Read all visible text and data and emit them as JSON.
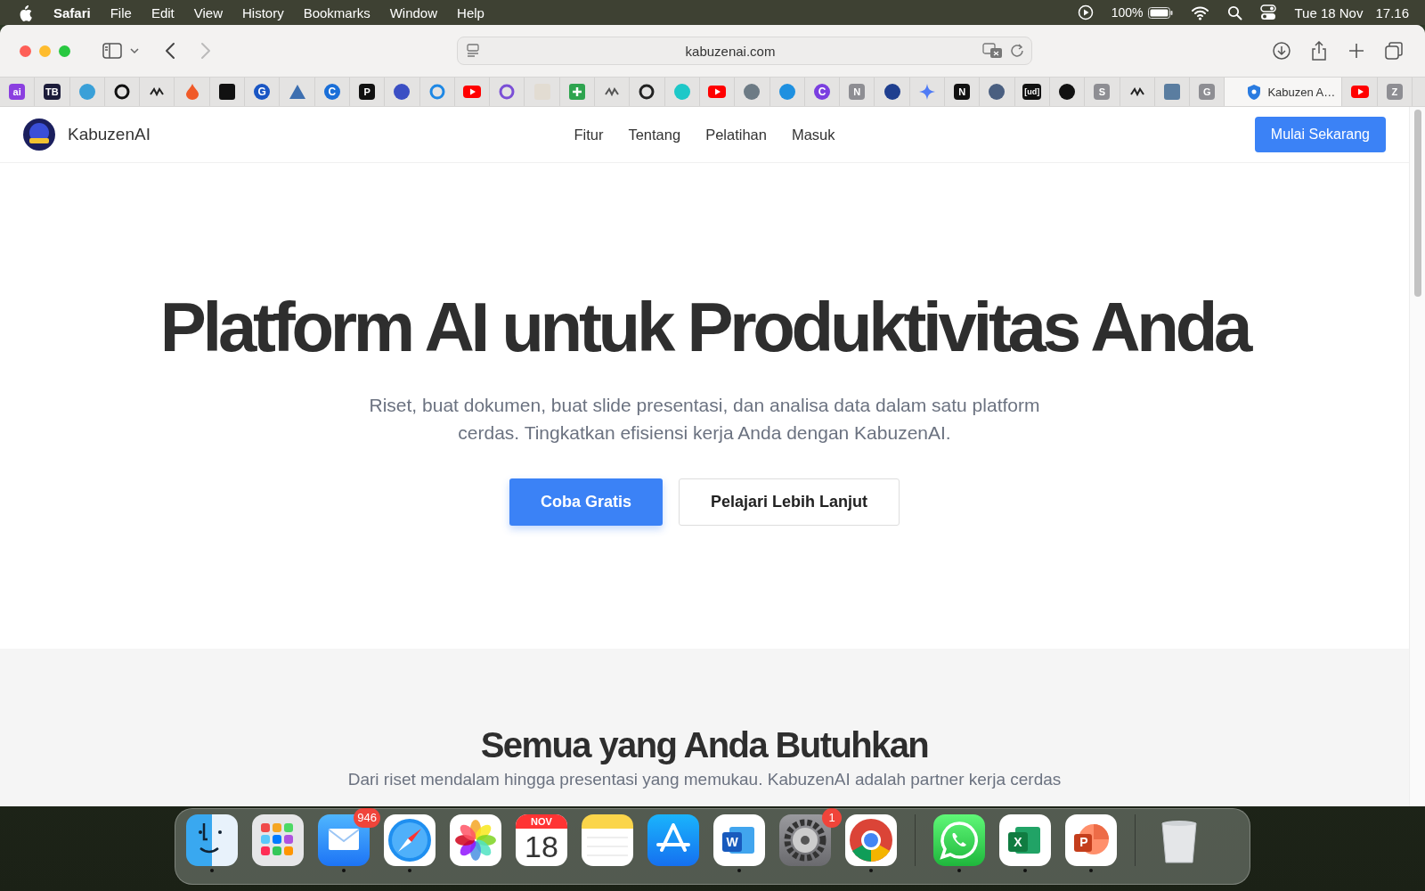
{
  "menu_bar": {
    "app": "Safari",
    "menus": [
      "File",
      "Edit",
      "View",
      "History",
      "Bookmarks",
      "Window",
      "Help"
    ],
    "battery": "100%",
    "date": "Tue 18 Nov",
    "time": "17.16"
  },
  "browser": {
    "address": "kabuzenai.com",
    "back_disabled": false,
    "forward_disabled": true
  },
  "tabs": [
    {
      "kind": "letter",
      "glyph": "ai",
      "color": "#8b3fe0",
      "selected": false
    },
    {
      "kind": "letter",
      "glyph": "TB",
      "color": "#1c1c3a",
      "selected": false
    },
    {
      "kind": "circle",
      "color": "#3aa0d8",
      "selected": false
    },
    {
      "kind": "ring",
      "color": "#111111",
      "selected": false
    },
    {
      "kind": "squiggle",
      "color": "#222222",
      "selected": false
    },
    {
      "kind": "drop",
      "color": "#f05a28",
      "selected": false
    },
    {
      "kind": "square",
      "color": "#111111",
      "selected": false
    },
    {
      "kind": "letter_round",
      "glyph": "G",
      "color": "#1a56c4",
      "selected": false
    },
    {
      "kind": "triangle",
      "color": "#3d6fb0",
      "selected": false
    },
    {
      "kind": "letter_round",
      "glyph": "C",
      "color": "#1a6fd8",
      "selected": false
    },
    {
      "kind": "letter",
      "glyph": "P",
      "color": "#111111",
      "selected": false
    },
    {
      "kind": "circle",
      "color": "#3b4fc4",
      "selected": false
    },
    {
      "kind": "ring",
      "color": "#1e88e5",
      "selected": false
    },
    {
      "kind": "play",
      "color": "#ff0000",
      "selected": false
    },
    {
      "kind": "ring",
      "color": "#7b4fd6",
      "selected": false
    },
    {
      "kind": "square",
      "color": "#e2dcd2",
      "selected": false
    },
    {
      "kind": "plus",
      "color": "#2ea44f",
      "selected": false
    },
    {
      "kind": "squiggle",
      "color": "#555555",
      "selected": false
    },
    {
      "kind": "ring",
      "color": "#222222",
      "selected": false
    },
    {
      "kind": "circle",
      "color": "#1ec8c8",
      "selected": false
    },
    {
      "kind": "play",
      "color": "#ff0000",
      "selected": false
    },
    {
      "kind": "circle",
      "color": "#6d7b85",
      "selected": false
    },
    {
      "kind": "circle",
      "color": "#1e90e0",
      "selected": false
    },
    {
      "kind": "letter_round",
      "glyph": "C",
      "color": "#7b3fe0",
      "selected": false
    },
    {
      "kind": "letter",
      "glyph": "N",
      "color": "#8e8e93",
      "selected": false
    },
    {
      "kind": "circle",
      "color": "#1f3f8f",
      "selected": false
    },
    {
      "kind": "star",
      "color": "#4f7bf5",
      "selected": false
    },
    {
      "kind": "letter",
      "glyph": "N",
      "color": "#111111",
      "selected": false
    },
    {
      "kind": "circle",
      "color": "#4a5f80",
      "selected": false
    },
    {
      "kind": "letter",
      "glyph": "[ud]",
      "color": "#111111",
      "selected": false
    },
    {
      "kind": "circle",
      "color": "#111111",
      "selected": false
    },
    {
      "kind": "letter",
      "glyph": "S",
      "color": "#8e8e93",
      "selected": false
    },
    {
      "kind": "squiggle",
      "color": "#222222",
      "selected": false
    },
    {
      "kind": "square",
      "color": "#5a7da0",
      "selected": false
    },
    {
      "kind": "letter",
      "glyph": "G",
      "color": "#8e8e93",
      "selected": false
    },
    {
      "kind": "shield",
      "title": "Kabuzen A…",
      "color": "#2a7be0",
      "selected": true
    },
    {
      "kind": "play",
      "color": "#ff0000",
      "selected": false
    },
    {
      "kind": "letter",
      "glyph": "Z",
      "color": "#8e8e93",
      "selected": false
    }
  ],
  "page": {
    "brand": "KabuzenAI",
    "nav": [
      "Fitur",
      "Tentang",
      "Pelatihan",
      "Masuk"
    ],
    "cta": "Mulai Sekarang",
    "hero": {
      "title": "Platform AI untuk Produktivitas Anda",
      "subtitle": "Riset, buat dokumen, buat slide presentasi, dan analisa data dalam satu platform cerdas. Tingkatkan efisiensi kerja Anda dengan KabuzenAI.",
      "primary": "Coba Gratis",
      "secondary": "Pelajari Lebih Lanjut"
    },
    "features": {
      "title": "Semua yang Anda Butuhkan",
      "subtitle": "Dari riset mendalam hingga presentasi yang memukau. KabuzenAI adalah partner kerja cerdas"
    }
  },
  "dock": [
    {
      "kind": "finder",
      "running": true
    },
    {
      "kind": "launchpad",
      "running": false
    },
    {
      "kind": "mail",
      "badge": "946",
      "running": true
    },
    {
      "kind": "safari",
      "running": true
    },
    {
      "kind": "photos",
      "running": false
    },
    {
      "kind": "calendar",
      "month": "NOV",
      "day": "18",
      "running": false
    },
    {
      "kind": "notes",
      "running": false
    },
    {
      "kind": "appstore",
      "running": false
    },
    {
      "kind": "word",
      "glyph": "W",
      "running": true
    },
    {
      "kind": "settings",
      "badge": "1",
      "running": false
    },
    {
      "kind": "chrome",
      "running": true
    },
    {
      "kind": "separator"
    },
    {
      "kind": "whatsapp",
      "running": true
    },
    {
      "kind": "excel",
      "glyph": "X",
      "running": true
    },
    {
      "kind": "powerpoint",
      "glyph": "P",
      "running": true
    },
    {
      "kind": "separator"
    },
    {
      "kind": "trash",
      "running": false
    }
  ]
}
